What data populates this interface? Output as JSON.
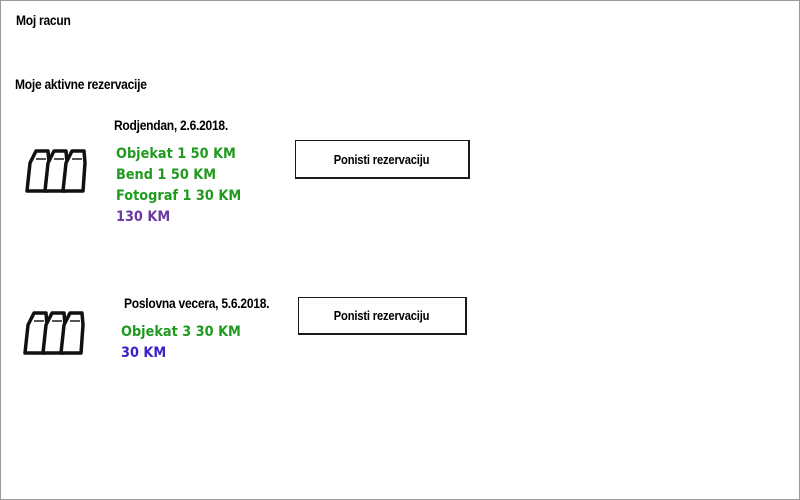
{
  "page": {
    "title": "Moj racun",
    "section_title": "Moje aktivne rezervacije"
  },
  "colors": {
    "item_text": "#1f9a1f",
    "total_text_first": "#6b3aa0",
    "total_text_second": "#3a22c8",
    "border": "#1a1a1a"
  },
  "reservations": [
    {
      "icon": "binoculars-icon",
      "title": "Rodjendan, 2.6.2018.",
      "items": [
        "Objekat 1 50 KM",
        "Bend 1 50 KM",
        "Fotograf 1 30 KM"
      ],
      "total": "130 KM",
      "cancel_label": "Ponisti rezervaciju"
    },
    {
      "icon": "binoculars-icon",
      "title": "Poslovna vecera, 5.6.2018.",
      "items": [
        "Objekat 3 30 KM"
      ],
      "total": "30 KM",
      "cancel_label": "Ponisti rezervaciju"
    }
  ]
}
